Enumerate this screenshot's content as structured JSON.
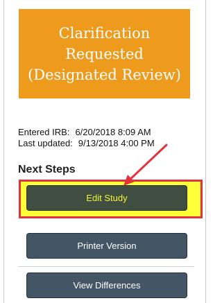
{
  "status": {
    "lines": [
      "Clarification",
      "Requested",
      "(Designated Review)"
    ],
    "color": "#ee9b1d"
  },
  "meta": {
    "entered_label": "Entered IRB:",
    "entered_value": "6/20/2018 8:09 AM",
    "updated_label": "Last updated:",
    "updated_value": "9/13/2018 4:00 PM"
  },
  "next_steps": {
    "heading": "Next Steps",
    "edit_label": "Edit Study",
    "printer_label": "Printer Version",
    "diff_label": "View Differences"
  },
  "annotation": {
    "highlight_color": "#ffff3a",
    "border_color": "#e3323b",
    "arrow_color": "#e3323b"
  }
}
